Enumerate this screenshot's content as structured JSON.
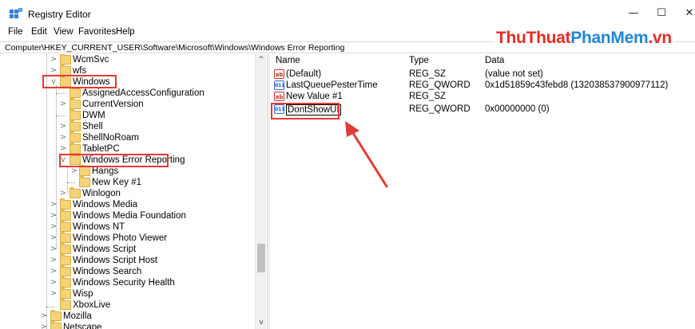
{
  "window": {
    "title": "Registry Editor",
    "minimize_glyph": "—",
    "maximize_glyph": "☐",
    "close_glyph": "✕"
  },
  "menu": [
    "File",
    "Edit",
    "View",
    "Favorites",
    "Help"
  ],
  "address": "Computer\\HKEY_CURRENT_USER\\Software\\Microsoft\\Windows\\Windows Error Reporting",
  "watermark": {
    "part1": "ThuThuat",
    "part2": "PhanMem",
    "part3": ".vn"
  },
  "tree": {
    "items": [
      {
        "label": "WcmSvc",
        "expander": ">"
      },
      {
        "label": "wfs",
        "expander": ">"
      },
      {
        "label": "Windows",
        "expander": "v"
      },
      {
        "label": "AssignedAccessConfiguration",
        "expander": ""
      },
      {
        "label": "CurrentVersion",
        "expander": ">"
      },
      {
        "label": "DWM",
        "expander": ""
      },
      {
        "label": "Shell",
        "expander": ">"
      },
      {
        "label": "ShellNoRoam",
        "expander": ">"
      },
      {
        "label": "TabletPC",
        "expander": ">"
      },
      {
        "label": "Windows Error Reporting",
        "expander": "v"
      },
      {
        "label": "Hangs",
        "expander": ">"
      },
      {
        "label": "New Key #1",
        "expander": ""
      },
      {
        "label": "Winlogon",
        "expander": ">"
      },
      {
        "label": "Windows Media",
        "expander": ">"
      },
      {
        "label": "Windows Media Foundation",
        "expander": ">"
      },
      {
        "label": "Windows NT",
        "expander": ">"
      },
      {
        "label": "Windows Photo Viewer",
        "expander": ">"
      },
      {
        "label": "Windows Script",
        "expander": ">"
      },
      {
        "label": "Windows Script Host",
        "expander": ">"
      },
      {
        "label": "Windows Search",
        "expander": ">"
      },
      {
        "label": "Windows Security Health",
        "expander": ">"
      },
      {
        "label": "Wisp",
        "expander": ">"
      },
      {
        "label": "XboxLive",
        "expander": ""
      },
      {
        "label": "Mozilla",
        "expander": ">"
      },
      {
        "label": "Netscape",
        "expander": ">"
      }
    ]
  },
  "scrollbar": {
    "up_glyph": "^",
    "down_glyph": "v"
  },
  "values": {
    "headers": {
      "name": "Name",
      "type": "Type",
      "data": "Data"
    },
    "rows": [
      {
        "icon": "string-value-icon",
        "icon_text": "ab",
        "name": "(Default)",
        "type": "REG_SZ",
        "data": "(value not set)"
      },
      {
        "icon": "binary-value-icon",
        "icon_text": "011",
        "name": "LastQueuePesterTime",
        "type": "REG_QWORD",
        "data": "0x1d51859c43febd8 (132038537900977112)"
      },
      {
        "icon": "string-value-icon",
        "icon_text": "ab",
        "name": "New Value #1",
        "type": "REG_SZ",
        "data": ""
      },
      {
        "icon": "binary-value-icon",
        "icon_text": "011",
        "name": "DontShowUI",
        "type": "REG_QWORD",
        "data": "0x00000000 (0)"
      }
    ]
  },
  "colors": {
    "highlight": "#e53935",
    "watermark_red": "#e52c25",
    "watermark_blue": "#1f86d8",
    "folder": "#f5d37a"
  }
}
